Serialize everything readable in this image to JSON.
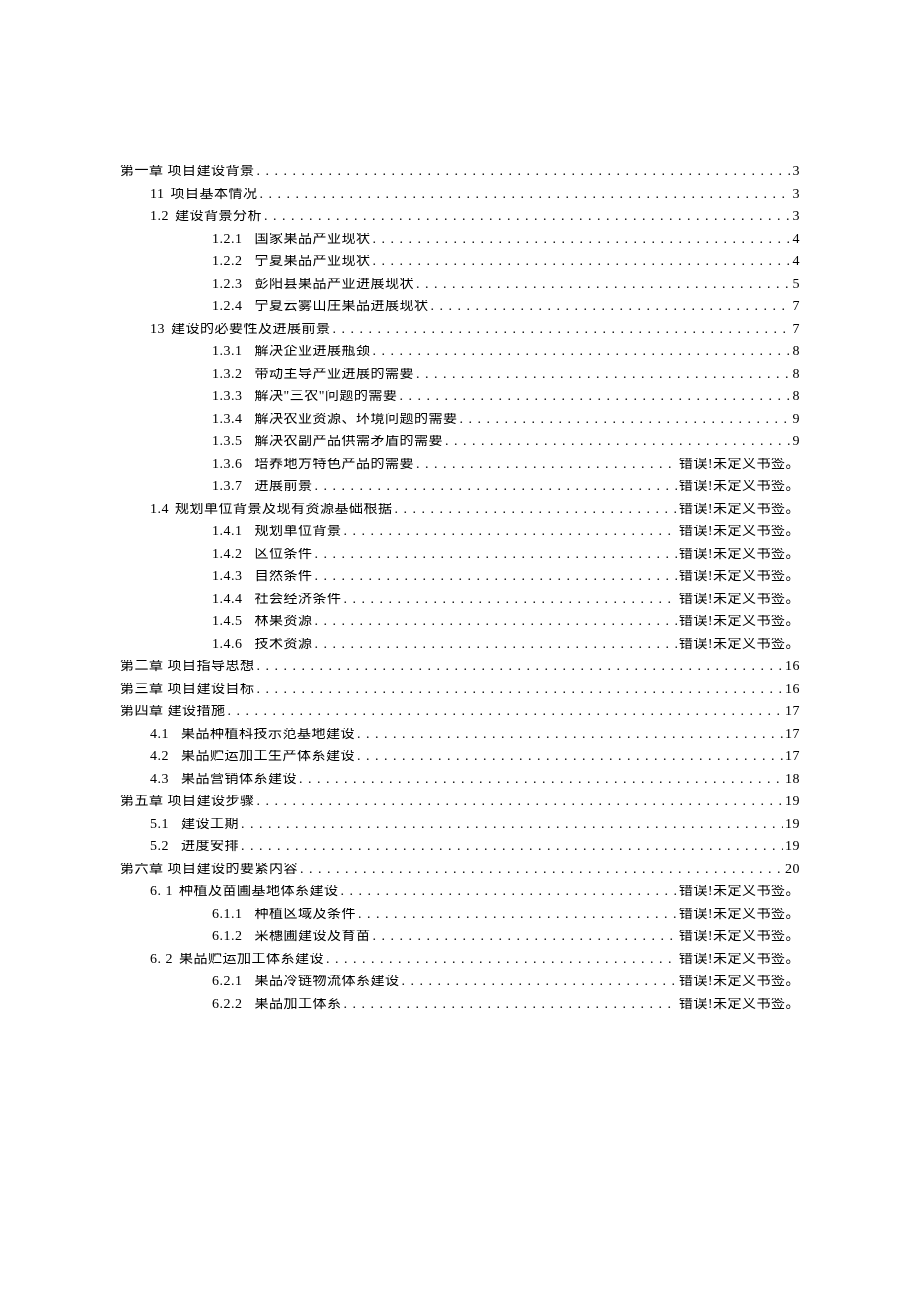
{
  "bookmark_error": "错误!未定义书签。",
  "toc": [
    {
      "level": 0,
      "num": "",
      "title": "第一章 项目建设背景",
      "page": "3"
    },
    {
      "level": 1,
      "num": "11",
      "title": "项目基本情况",
      "page": "3",
      "numStyle": "gap2"
    },
    {
      "level": 1,
      "num": "1.2",
      "title": "建设背景分析",
      "page": "3",
      "numStyle": "gap2"
    },
    {
      "level": 2,
      "num": "1.2.1",
      "title": "国家果品产业现状",
      "page": "4",
      "numStyle": "gap"
    },
    {
      "level": 2,
      "num": "1.2.2",
      "title": "宁夏果品产业现状",
      "page": "4",
      "numStyle": "gap"
    },
    {
      "level": 2,
      "num": "1.2.3",
      "title": "彭阳县果品产业进展现状",
      "page": "5",
      "numStyle": "gap"
    },
    {
      "level": 2,
      "num": "1.2.4",
      "title": "宁夏云雾山庄果品进展现状",
      "page": "7",
      "numStyle": "gap"
    },
    {
      "level": 1,
      "num": "13",
      "title": "建设的必要性及进展前景",
      "page": "7",
      "numStyle": "gap2"
    },
    {
      "level": 2,
      "num": "1.3.1",
      "title": "解决企业进展瓶颈",
      "page": "8",
      "numStyle": "gap"
    },
    {
      "level": 2,
      "num": "1.3.2",
      "title": "带动主导产业进展的需要",
      "page": "8",
      "numStyle": "gap"
    },
    {
      "level": 2,
      "num": "1.3.3",
      "title": "解决\"三农\"问题的需要",
      "page": "8",
      "numStyle": "gap"
    },
    {
      "level": 2,
      "num": "1.3.4",
      "title": "解决农业资源、环境问题的需要",
      "page": "9",
      "numStyle": "gap"
    },
    {
      "level": 2,
      "num": "1.3.5",
      "title": "解决农副产品供需矛盾的需要",
      "page": "9",
      "numStyle": "gap"
    },
    {
      "level": 2,
      "num": "1.3.6",
      "title": "培养地方特色产品的需要",
      "page": "ERR",
      "numStyle": "gap"
    },
    {
      "level": 2,
      "num": "1.3.7",
      "title": "进展前景",
      "page": "ERR",
      "numStyle": "gap"
    },
    {
      "level": 1,
      "num": "1.4",
      "title": "规划单位背景及现有资源基础根据",
      "page": "ERR",
      "numStyle": "gap2"
    },
    {
      "level": 2,
      "num": "1.4.1",
      "title": "规划单位背景",
      "page": "ERR",
      "numStyle": "gap"
    },
    {
      "level": 2,
      "num": "1.4.2",
      "title": "区位条件",
      "page": "ERR",
      "numStyle": "gap"
    },
    {
      "level": 2,
      "num": "1.4.3",
      "title": "自然条件",
      "page": "ERR",
      "numStyle": "gap"
    },
    {
      "level": 2,
      "num": "1.4.4",
      "title": "社会经济条件",
      "page": "ERR",
      "numStyle": "gap"
    },
    {
      "level": 2,
      "num": "1.4.5",
      "title": "林果资源",
      "page": "ERR",
      "numStyle": "gap"
    },
    {
      "level": 2,
      "num": "1.4.6",
      "title": "技术资源",
      "page": "ERR",
      "numStyle": "gap"
    },
    {
      "level": 0,
      "num": "",
      "title": "第二章 项目指导思想",
      "page": "16"
    },
    {
      "level": 0,
      "num": "",
      "title": "第三章 项目建设目标",
      "page": "16"
    },
    {
      "level": 0,
      "num": "",
      "title": "第四章 建设措施",
      "page": "17"
    },
    {
      "level": 1,
      "num": "4.1",
      "title": "果品种植科技示范基地建设",
      "page": "17",
      "numStyle": "gap"
    },
    {
      "level": 1,
      "num": "4.2",
      "title": "果品贮运加工生产体系建设",
      "page": "17",
      "numStyle": "gap"
    },
    {
      "level": 1,
      "num": "4.3",
      "title": "果品营销体系建设",
      "page": "18",
      "numStyle": "gap"
    },
    {
      "level": 0,
      "num": "",
      "title": "第五章 项目建设步骤",
      "page": "19"
    },
    {
      "level": 1,
      "num": "5.1",
      "title": "建设工期",
      "page": "19",
      "numStyle": "gap"
    },
    {
      "level": 1,
      "num": "5.2",
      "title": "进度安排",
      "page": "19",
      "numStyle": "gap"
    },
    {
      "level": 0,
      "num": "",
      "title": "第六章 项目建设的要紧内容",
      "page": "20"
    },
    {
      "level": 1,
      "num": "6. 1",
      "title": "种植及苗圃基地体系建设",
      "page": "ERR",
      "numStyle": "gap2"
    },
    {
      "level": 2,
      "num": "6.1.1",
      "title": "种植区域及条件",
      "page": "ERR",
      "numStyle": "gap"
    },
    {
      "level": 2,
      "num": "6.1.2",
      "title": "采穗圃建设及育苗",
      "page": "ERR",
      "numStyle": "gap"
    },
    {
      "level": 1,
      "num": "6. 2",
      "title": "果品贮运加工体系建设",
      "page": "ERR",
      "numStyle": "gap2"
    },
    {
      "level": 2,
      "num": "6.2.1",
      "title": "果品冷链物流体系建设",
      "page": "ERR",
      "numStyle": "gap"
    },
    {
      "level": 2,
      "num": "6.2.2",
      "title": "果品加工体系",
      "page": "ERR",
      "numStyle": "gap"
    }
  ]
}
